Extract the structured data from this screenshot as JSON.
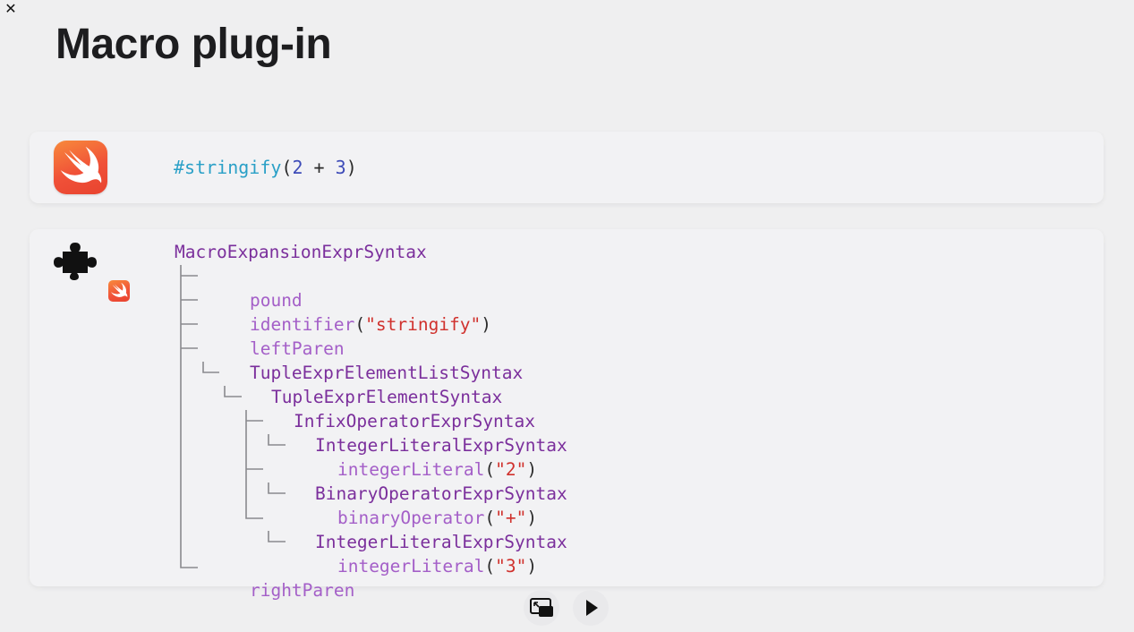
{
  "window": {
    "close_icon": "close-icon",
    "close_symbol": "✕"
  },
  "slide": {
    "title": "Macro plug-in"
  },
  "source_card": {
    "icon": "swift-logo-icon",
    "code": {
      "macro": "#stringify",
      "open": "(",
      "lhs": "2",
      "op": " + ",
      "rhs": "3",
      "close": ")"
    }
  },
  "tree_card": {
    "icon": "puzzle-plugin-icon",
    "badge_icon": "swift-badge-icon",
    "root": "MacroExpansionExprSyntax",
    "nodes": [
      {
        "kind": "token",
        "name": "pound"
      },
      {
        "kind": "token",
        "name": "identifier",
        "arg": "\"stringify\""
      },
      {
        "kind": "token",
        "name": "leftParen"
      },
      {
        "kind": "type",
        "name": "TupleExprElementListSyntax"
      },
      {
        "kind": "type",
        "name": "TupleExprElementSyntax"
      },
      {
        "kind": "type",
        "name": "InfixOperatorExprSyntax"
      },
      {
        "kind": "type",
        "name": "IntegerLiteralExprSyntax"
      },
      {
        "kind": "token",
        "name": "integerLiteral",
        "arg": "\"2\""
      },
      {
        "kind": "type",
        "name": "BinaryOperatorExprSyntax"
      },
      {
        "kind": "token",
        "name": "binaryOperator",
        "arg": "\"+\""
      },
      {
        "kind": "type",
        "name": "IntegerLiteralExprSyntax"
      },
      {
        "kind": "token",
        "name": "integerLiteral",
        "arg": "\"3\""
      },
      {
        "kind": "token",
        "name": "rightParen"
      }
    ]
  },
  "controls": {
    "pip_icon": "picture-in-picture-icon",
    "play_icon": "play-icon"
  },
  "colors": {
    "background": "#efeff0",
    "card": "#f2f2f4",
    "swift_orange": "#f05138",
    "type_purple": "#7b2f9c",
    "token_purple": "#a45fc8",
    "string_red": "#d0312d",
    "macro_teal": "#2aa0c7",
    "number_blue": "#3d4bb8"
  }
}
